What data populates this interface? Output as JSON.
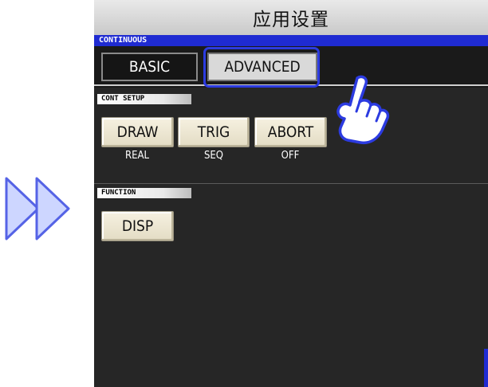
{
  "window": {
    "title": "应用设置"
  },
  "mode_bar": {
    "label": "CONTINUOUS"
  },
  "tabs": [
    {
      "label": "BASIC",
      "selected": false
    },
    {
      "label": "ADVANCED",
      "selected": true
    }
  ],
  "cont_setup": {
    "header": "CONT SETUP",
    "buttons": [
      {
        "label": "DRAW",
        "value": "REAL"
      },
      {
        "label": "TRIG",
        "value": "SEQ"
      },
      {
        "label": "ABORT",
        "value": "OFF"
      }
    ]
  },
  "function": {
    "header": "FUNCTION",
    "buttons": [
      {
        "label": "DISP"
      }
    ]
  },
  "icons": {
    "nav_arrows": "double-right-arrow-icon",
    "pointer": "pointing-hand-icon"
  },
  "colors": {
    "accent_blue": "#1f2bd2",
    "highlight_blue": "#2c3be0",
    "button_face": "#efe9d4",
    "screen_bg": "#262626",
    "arrow_fill": "#cdd6ff"
  }
}
